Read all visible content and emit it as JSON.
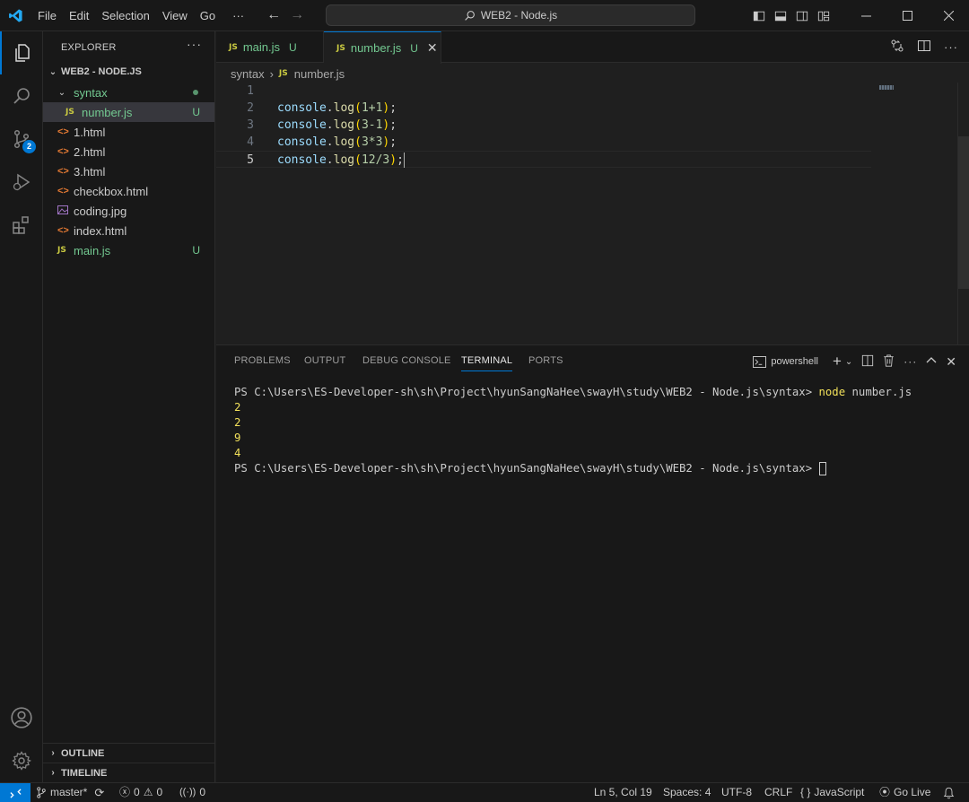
{
  "titlebar": {
    "menu": [
      "File",
      "Edit",
      "Selection",
      "View",
      "Go"
    ],
    "more": "···",
    "search": "WEB2 - Node.js",
    "colors": {
      "logo": "#23a9f2",
      "accent": "#0078d4"
    }
  },
  "activity": {
    "source_control_badge": "2"
  },
  "explorer": {
    "title": "EXPLORER",
    "more": "···",
    "root": "WEB2 - NODE.JS",
    "folder": "syntax",
    "items": [
      {
        "label": "number.js",
        "icon": "js-icon",
        "git": "U"
      },
      {
        "label": "1.html",
        "icon": "html-icon"
      },
      {
        "label": "2.html",
        "icon": "html-icon"
      },
      {
        "label": "3.html",
        "icon": "html-icon"
      },
      {
        "label": "checkbox.html",
        "icon": "html-icon"
      },
      {
        "label": "coding.jpg",
        "icon": "image-icon"
      },
      {
        "label": "index.html",
        "icon": "html-icon"
      },
      {
        "label": "main.js",
        "icon": "js-icon",
        "git": "U"
      }
    ],
    "outline": "OUTLINE",
    "timeline": "TIMELINE"
  },
  "tabs": [
    {
      "label": "main.js",
      "status": "U"
    },
    {
      "label": "number.js",
      "status": "U"
    }
  ],
  "breadcrumb": {
    "folder": "syntax",
    "file": "number.js"
  },
  "code": {
    "line_numbers": [
      "1",
      "2",
      "3",
      "4",
      "5"
    ],
    "lines": [
      {
        "obj": "",
        "fn": "",
        "arg": ""
      },
      {
        "obj": "console",
        "fn": "log",
        "arg": "1+1"
      },
      {
        "obj": "console",
        "fn": "log",
        "arg": "3-1"
      },
      {
        "obj": "console",
        "fn": "log",
        "arg": "3*3"
      },
      {
        "obj": "console",
        "fn": "log",
        "arg": "12/3"
      }
    ]
  },
  "panel": {
    "tabs": [
      "PROBLEMS",
      "OUTPUT",
      "DEBUG CONSOLE",
      "TERMINAL",
      "PORTS"
    ],
    "shell": "powershell",
    "terminal": {
      "prompt": "PS C:\\Users\\ES-Developer-sh\\sh\\Project\\hyunSangNaHee\\swayH\\study\\WEB2 - Node.js\\syntax> ",
      "command": "node",
      "command_arg": " number.js",
      "output": [
        "2",
        "2",
        "9",
        "4"
      ],
      "prompt2": "PS C:\\Users\\ES-Developer-sh\\sh\\Project\\hyunSangNaHee\\swayH\\study\\WEB2 - Node.js\\syntax> "
    }
  },
  "statusbar": {
    "branch": "master*",
    "errors": "0",
    "warnings": "0",
    "ports": "0",
    "position": "Ln 5, Col 19",
    "spaces": "Spaces: 4",
    "encoding": "UTF-8",
    "eol": "CRLF",
    "language_prefix": "{ }",
    "language": "JavaScript",
    "golive": "Go Live"
  }
}
